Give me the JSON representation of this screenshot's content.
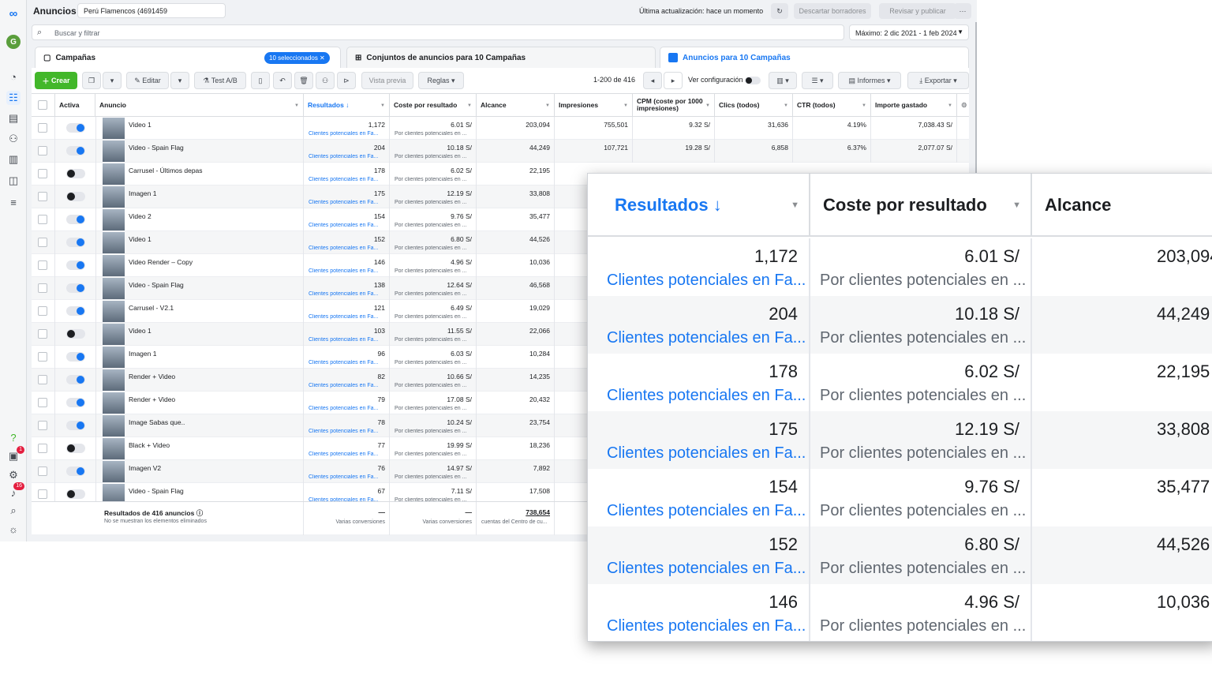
{
  "app": {
    "title": "Anuncios",
    "account": "Perú Flamencos (4691459",
    "last_update": "Última actualización: hace un momento",
    "discard_label": "Descartar borradores",
    "review_label": "Revisar y publicar",
    "more_label": "···"
  },
  "rail": {
    "avatar_letter": "G",
    "notifications_badge": "1",
    "alerts_badge": "16"
  },
  "search": {
    "placeholder": "Buscar y filtrar",
    "date_range": "Máximo: 2 dic 2021 - 1 feb 2024"
  },
  "tabs": {
    "campaigns": "Campañas",
    "selected_pill": "10 seleccionados",
    "adsets": "Conjuntos de anuncios para 10 Campañas",
    "ads": "Anuncios para 10 Campañas"
  },
  "toolbar": {
    "create": "Crear",
    "edit": "Editar",
    "ab_test": "Test A/B",
    "preview": "Vista previa",
    "rules": "Reglas",
    "pagination": "1-200 de 416",
    "view_config": "Ver configuración",
    "reports": "Informes",
    "export": "Exportar"
  },
  "columns": {
    "active": "Activa",
    "ad": "Anuncio",
    "results": "Resultados ↓",
    "cost": "Coste por resultado",
    "reach": "Alcance",
    "impressions": "Impresiones",
    "cpm": "CPM (coste por 1000 impresiones)",
    "clicks": "Clics (todos)",
    "ctr": "CTR (todos)",
    "spent": "Importe gastado"
  },
  "sub_labels": {
    "results": "Clientes potenciales en Fa...",
    "cost": "Por clientes potenciales en ..."
  },
  "rows": [
    {
      "name": "Video 1",
      "on": true,
      "results": "1,172",
      "cost": "6.01 S/",
      "reach": "203,094",
      "impressions": "755,501",
      "cpm": "9.32 S/",
      "clicks": "31,636",
      "ctr": "4.19%",
      "spent": "7,038.43 S/"
    },
    {
      "name": "Video - Spain Flag",
      "on": true,
      "results": "204",
      "cost": "10.18 S/",
      "reach": "44,249",
      "impressions": "107,721",
      "cpm": "19.28 S/",
      "clicks": "6,858",
      "ctr": "6.37%",
      "spent": "2,077.07 S/"
    },
    {
      "name": "Carrusel - Últimos depas",
      "on": false,
      "results": "178",
      "cost": "6.02 S/",
      "reach": "22,195"
    },
    {
      "name": "Imagen 1",
      "on": false,
      "results": "175",
      "cost": "12.19 S/",
      "reach": "33,808"
    },
    {
      "name": "Video 2",
      "on": true,
      "results": "154",
      "cost": "9.76 S/",
      "reach": "35,477"
    },
    {
      "name": "Video 1",
      "on": true,
      "results": "152",
      "cost": "6.80 S/",
      "reach": "44,526"
    },
    {
      "name": "Video Render – Copy",
      "on": true,
      "results": "146",
      "cost": "4.96 S/",
      "reach": "10,036"
    },
    {
      "name": "Video - Spain Flag",
      "on": true,
      "results": "138",
      "cost": "12.64 S/",
      "reach": "46,568"
    },
    {
      "name": "Carrusel - V2.1",
      "on": true,
      "results": "121",
      "cost": "6.49 S/",
      "reach": "19,029"
    },
    {
      "name": "Video 1",
      "on": false,
      "results": "103",
      "cost": "11.55 S/",
      "reach": "22,066"
    },
    {
      "name": "Imagen 1",
      "on": true,
      "results": "96",
      "cost": "6.03 S/",
      "reach": "10,284"
    },
    {
      "name": "Render + Video",
      "on": true,
      "results": "82",
      "cost": "10.66 S/",
      "reach": "14,235"
    },
    {
      "name": "Render + Video",
      "on": true,
      "results": "79",
      "cost": "17.08 S/",
      "reach": "20,432"
    },
    {
      "name": "Image Sabas que..",
      "on": true,
      "results": "78",
      "cost": "10.24 S/",
      "reach": "23,754"
    },
    {
      "name": "Black + Video",
      "on": false,
      "results": "77",
      "cost": "19.99 S/",
      "reach": "18,236"
    },
    {
      "name": "Imagen V2",
      "on": true,
      "results": "76",
      "cost": "14.97 S/",
      "reach": "7,892"
    },
    {
      "name": "Video - Spain Flag",
      "on": false,
      "results": "67",
      "cost": "7.11 S/",
      "reach": "17,508"
    }
  ],
  "footer": {
    "title": "Resultados de 416 anuncios",
    "subtitle": "No se muestran los elementos eliminados",
    "results_dash": "—",
    "results_note": "Varias conversiones",
    "cost_dash": "—",
    "cost_note": "Varias conversiones",
    "reach_total": "738,654",
    "reach_note": "cuentas del Centro de cu..."
  },
  "zoom": {
    "headers": [
      "Resultados ↓",
      "Coste por resultado",
      "Alcance"
    ],
    "rows": [
      {
        "results": "1,172",
        "cost": "6.01 S/",
        "reach": "203,094"
      },
      {
        "results": "204",
        "cost": "10.18 S/",
        "reach": "44,249"
      },
      {
        "results": "178",
        "cost": "6.02 S/",
        "reach": "22,195"
      },
      {
        "results": "175",
        "cost": "12.19 S/",
        "reach": "33,808"
      },
      {
        "results": "154",
        "cost": "9.76 S/",
        "reach": "35,477"
      },
      {
        "results": "152",
        "cost": "6.80 S/",
        "reach": "44,526"
      },
      {
        "results": "146",
        "cost": "4.96 S/",
        "reach": "10,036"
      }
    ]
  }
}
